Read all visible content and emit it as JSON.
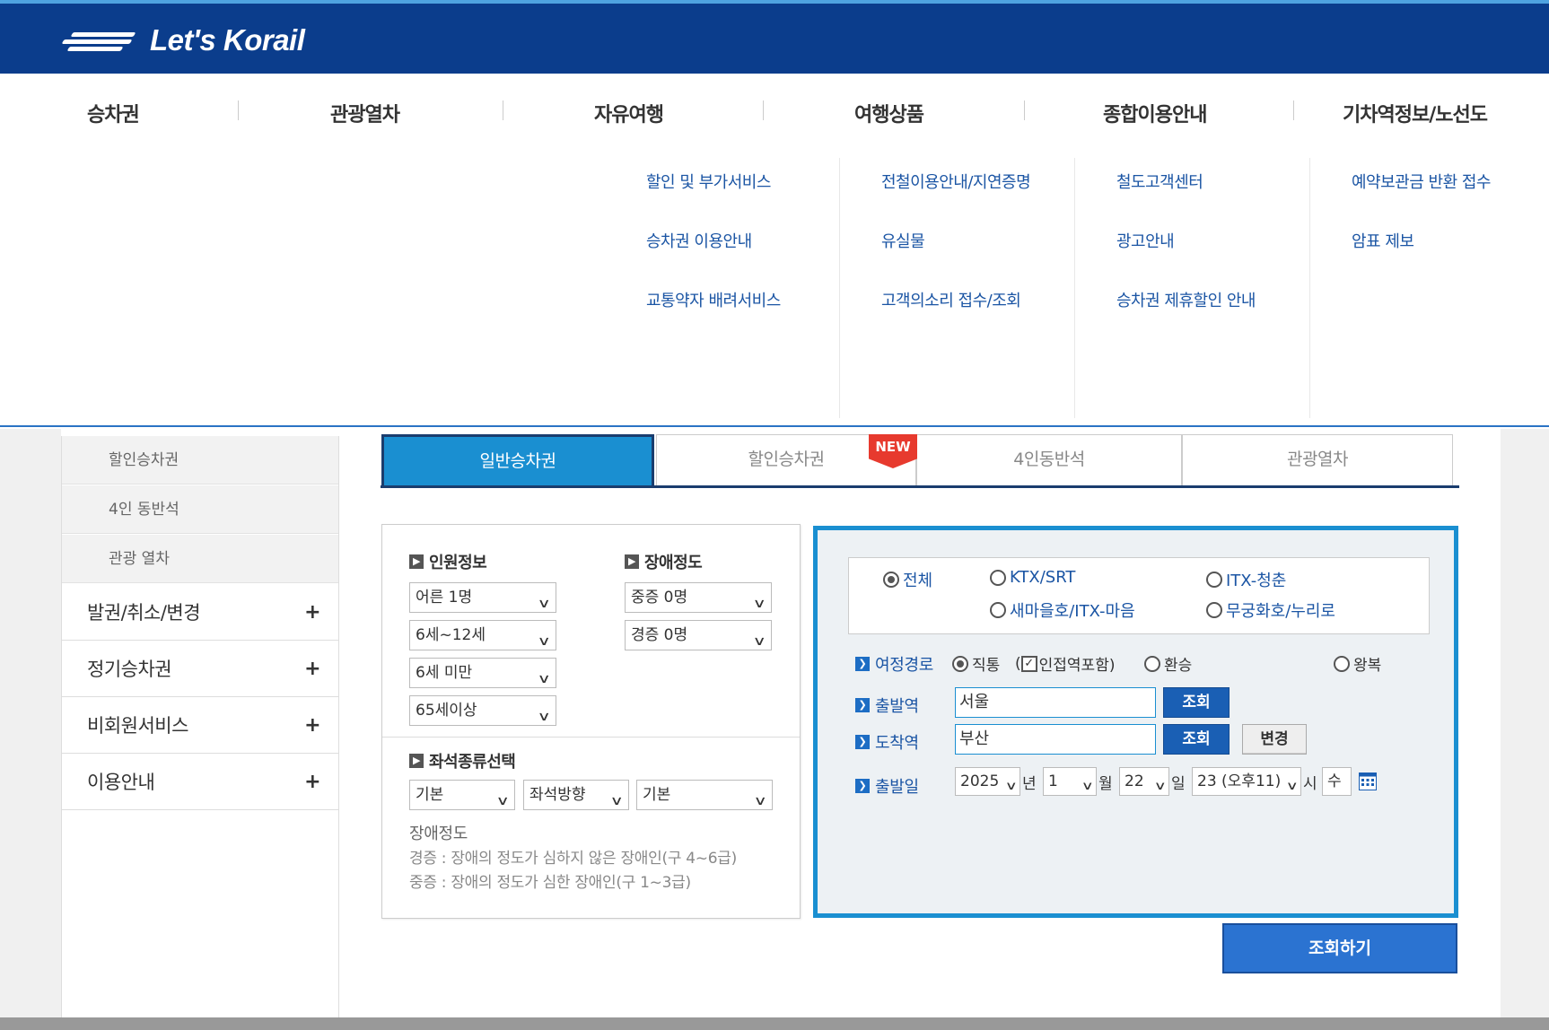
{
  "header": {
    "logo_text": "Let's Korail"
  },
  "gnb": [
    "승차권",
    "관광열차",
    "자유여행",
    "여행상품",
    "종합이용안내",
    "기차역정보/노선도"
  ],
  "submenu": {
    "col1": [
      "할인 및 부가서비스",
      "승차권 이용안내",
      "교통약자 배려서비스"
    ],
    "col2": [
      "전철이용안내/지연증명",
      "유실물",
      "고객의소리 접수/조회"
    ],
    "col3": [
      "철도고객센터",
      "광고안내",
      "승차권 제휴할인 안내"
    ],
    "col4": [
      "예약보관금 반환 접수",
      "암표 제보"
    ]
  },
  "lnb": {
    "subs": [
      "할인승차권",
      "4인 동반석",
      "관광 열차"
    ],
    "mains": [
      "발권/취소/변경",
      "정기승차권",
      "비회원서비스",
      "이용안내"
    ],
    "plus": "+"
  },
  "tabs": [
    "일반승차권",
    "할인승차권",
    "4인동반석",
    "관광열차"
  ],
  "new_badge": "NEW",
  "people": {
    "title": "인원정보",
    "selects": [
      "어른 1명",
      "6세~12세",
      "6세 미만",
      "65세이상"
    ]
  },
  "disability": {
    "title": "장애정도",
    "selects": [
      "중증 0명",
      "경증 0명"
    ]
  },
  "seat": {
    "title": "좌석종류선택",
    "selects": [
      "기본",
      "좌석방향",
      "기본"
    ]
  },
  "notes": {
    "title": "장애정도",
    "line1": "경증 : 장애의 정도가 심하지 않은 장애인(구 4~6급)",
    "line2": "중증 : 장애의 정도가 심한 장애인(구 1~3급)"
  },
  "train_types": [
    "전체",
    "KTX/SRT",
    "ITX-청춘",
    "새마을호/ITX-마음",
    "무궁화호/누리로"
  ],
  "route": {
    "label": "여정경로",
    "direct": "직통",
    "nearby": "인접역포함)",
    "nearby_prefix": "(",
    "transfer": "환승",
    "round": "왕복"
  },
  "departure": {
    "label": "출발역",
    "value": "서울",
    "button": "조회"
  },
  "arrival": {
    "label": "도착역",
    "value": "부산",
    "button": "조회",
    "swap": "변경"
  },
  "date": {
    "label": "출발일",
    "year": "2025",
    "year_unit": "년",
    "month": "1",
    "month_unit": "월",
    "day": "22",
    "day_unit": "일",
    "hour": "23 (오후11)",
    "hour_unit": "시",
    "weekday": "수"
  },
  "search_button": "조회하기",
  "colors": {
    "header": "#0b3d8c",
    "accent": "#1a8fd1",
    "link": "#1b55a4",
    "new": "#e73a2e"
  }
}
